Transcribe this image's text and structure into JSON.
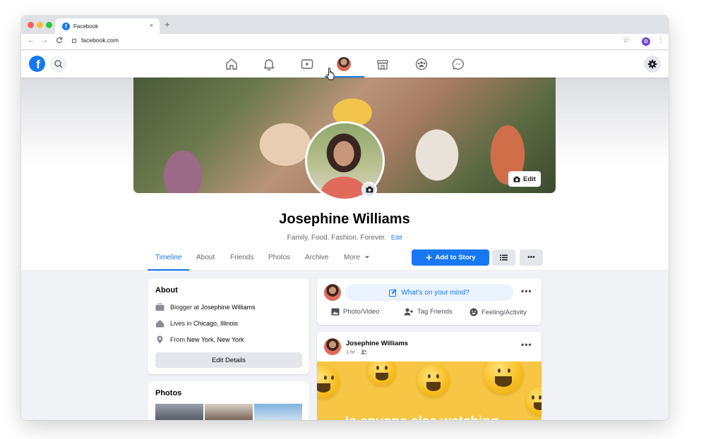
{
  "browser": {
    "tab_title": "Facebook",
    "tab_close": "×",
    "new_tab": "+",
    "url": "facebook.com",
    "profile_initial": "D",
    "back": "←",
    "forward": "→",
    "reload": "C",
    "star": "☆",
    "menu": "⋮"
  },
  "fb": {
    "logo_letter": "f",
    "nav": [
      "home-icon",
      "notifications-icon",
      "watch-icon",
      "profile-avatar",
      "marketplace-icon",
      "groups-icon",
      "messenger-icon"
    ],
    "active_nav": "profile-avatar",
    "brand_color": "#1877f2"
  },
  "profile": {
    "cover_edit_label": "Edit",
    "name": "Josephine Williams",
    "bio": "Family. Food. Fashion. Forever.",
    "bio_edit": "Edit"
  },
  "tabs": {
    "items": [
      "Timeline",
      "About",
      "Friends",
      "Photos",
      "Archive",
      "More"
    ],
    "active": "Timeline",
    "add_story": "Add to Story",
    "list_icon": "☰",
    "more_icon": "•••"
  },
  "about": {
    "title": "About",
    "rows": [
      {
        "prefix": "Blogger at",
        "value": "Josephine Williams",
        "icon": "briefcase-icon"
      },
      {
        "prefix": "Lives in",
        "value": "Chicago, Illinois",
        "icon": "home-icon"
      },
      {
        "prefix": "From",
        "value": "New York, New York",
        "icon": "location-pin-icon"
      }
    ],
    "edit_details": "Edit Details"
  },
  "photos": {
    "title": "Photos"
  },
  "composer": {
    "prompt": "What's on your mind?",
    "more": "•••",
    "actions": [
      "Photo/Video",
      "Tag Friends",
      "Feeling/Activity"
    ]
  },
  "post": {
    "author": "Josephine Williams",
    "time": "1 hr",
    "separator": "·",
    "more": "•••",
    "overlay_text": "Is anyone else watching"
  }
}
